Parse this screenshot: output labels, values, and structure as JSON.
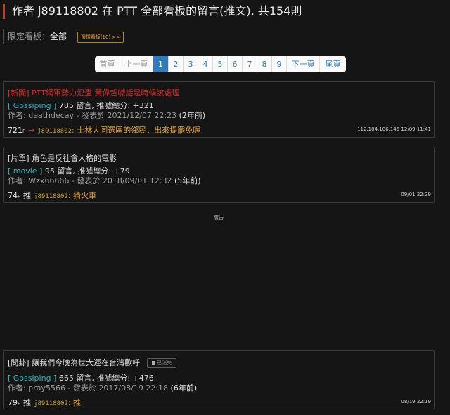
{
  "header": {
    "title": "作者 j89118802 在 PTT 全部看板的留言(推文), 共154則"
  },
  "filter": {
    "label": "限定看板：",
    "value": "全部",
    "choose_button": "選擇看板(10) >>"
  },
  "pagination": {
    "first": "首頁",
    "prev": "上一頁",
    "pages": [
      "1",
      "2",
      "3",
      "4",
      "5",
      "6",
      "7",
      "8",
      "9"
    ],
    "current": "1",
    "next": "下一頁",
    "last": "尾頁"
  },
  "posts": [
    {
      "title": "[新聞] PTT網軍勢力氾濫 黃偉哲喊話是時候該處理",
      "board": "[ Gossiping ]",
      "comments": "785",
      "comments_label": "留言, 推噓總分:",
      "score": "+321",
      "author_prefix": "作者:",
      "author": "deathdecay",
      "posted_label": "- 發表於",
      "posted": "2021/12/07 22:23",
      "ago": "(2年前)",
      "floor": "721",
      "floor_suffix": "F",
      "tag": "→",
      "comment_user": "j89118802",
      "comment_text": ": 士林大同選區的鄉民．出來提罷免喔",
      "meta": "112.104.106.145 12/09 11:41"
    },
    {
      "title": "[片單] 角色是反社會人格的電影",
      "board": "[ movie ]",
      "comments": "95",
      "comments_label": "留言, 推噓總分:",
      "score": "+79",
      "author_prefix": "作者:",
      "author": "Wzx66666",
      "posted_label": "- 發表於",
      "posted": "2018/09/01 12:32",
      "ago": "(5年前)",
      "floor": "74",
      "floor_suffix": "F",
      "tag": "推",
      "comment_user": "j89118802",
      "comment_text": ": 猜火車",
      "meta": "09/01 22:29"
    },
    {
      "title": "[問卦] 讓我們今晚為世大運在台灣歡呼",
      "deleted_label": "已消失",
      "board": "[ Gossiping ]",
      "comments": "665",
      "comments_label": "留言, 推噓總分:",
      "score": "+476",
      "author_prefix": "作者:",
      "author": "pray5566",
      "posted_label": "- 發表於",
      "posted": "2017/08/19 22:18",
      "ago": "(6年前)",
      "floor": "79",
      "floor_suffix": "F",
      "tag": "推",
      "comment_user": "j89118802",
      "comment_text": ": 推",
      "meta": "08/19 22:19"
    }
  ],
  "ad": {
    "label": "廣告"
  },
  "colors": {
    "accent": "#c0392b",
    "board": "#2bb3c4",
    "hot_title": "#d62b2b",
    "comment": "#e0a040",
    "pager_active": "#337ab7"
  }
}
